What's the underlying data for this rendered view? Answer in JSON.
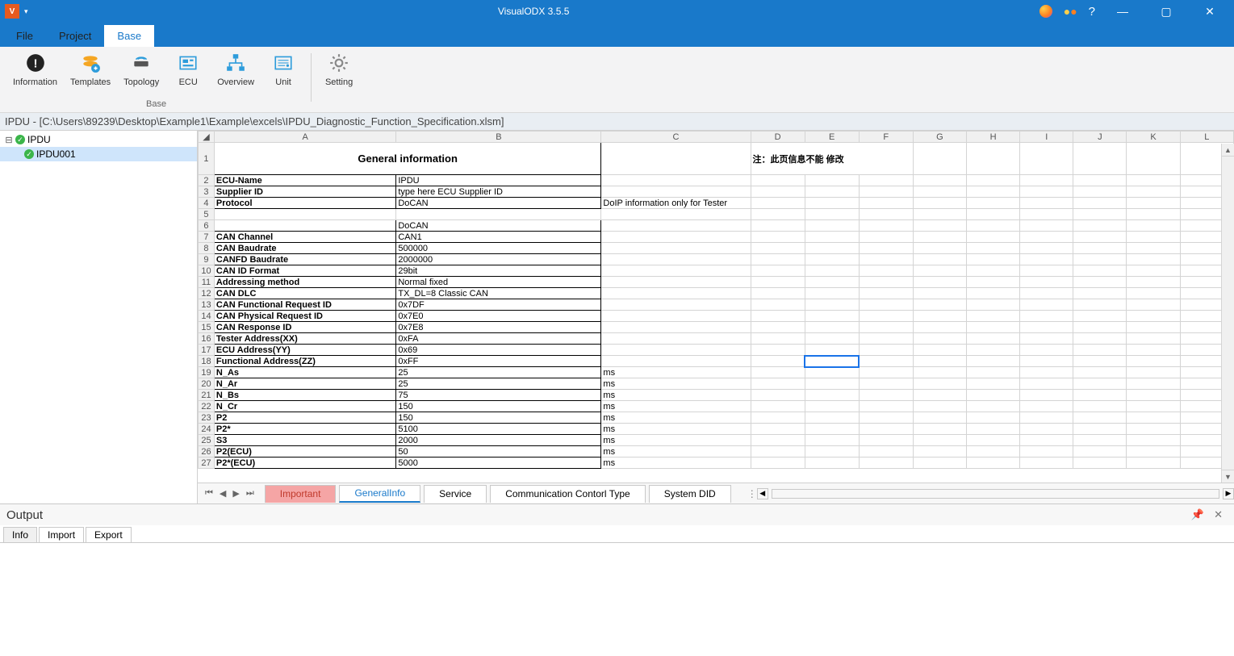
{
  "app": {
    "title": "VisualODX 3.5.5",
    "logo": "V"
  },
  "menuTabs": [
    {
      "label": "File",
      "active": false
    },
    {
      "label": "Project",
      "active": false
    },
    {
      "label": "Base",
      "active": true
    }
  ],
  "ribbon": {
    "groups": [
      {
        "label": "Base",
        "items": [
          {
            "label": "Information",
            "icon": "info"
          },
          {
            "label": "Templates",
            "icon": "templates"
          },
          {
            "label": "Topology",
            "icon": "topology"
          },
          {
            "label": "ECU",
            "icon": "ecu"
          },
          {
            "label": "Overview",
            "icon": "overview"
          },
          {
            "label": "Unit",
            "icon": "unit"
          }
        ]
      },
      {
        "label": "",
        "items": [
          {
            "label": "Setting",
            "icon": "setting"
          }
        ]
      }
    ]
  },
  "breadcrumb": "IPDU - [C:\\Users\\89239\\Desktop\\Example1\\Example\\excels\\IPDU_Diagnostic_Function_Specification.xlsm]",
  "tree": {
    "root": {
      "label": "IPDU"
    },
    "child": {
      "label": "IPDU001"
    }
  },
  "sheet": {
    "columns": [
      "A",
      "B",
      "C",
      "D",
      "E",
      "F",
      "G",
      "H",
      "I",
      "J",
      "K",
      "L"
    ],
    "title": "General information",
    "note": "注：此页信息不能 修改",
    "rows": [
      {
        "n": 2,
        "a": "ECU-Name",
        "b": "IPDU",
        "c": "",
        "bold": true,
        "thick": true
      },
      {
        "n": 3,
        "a": "Supplier ID",
        "b": "type here ECU Supplier ID",
        "c": "",
        "bold": true,
        "thick": true
      },
      {
        "n": 4,
        "a": "Protocol",
        "b": "DoCAN",
        "c": "DoIP information only for Tester",
        "bold": true,
        "thick": true
      },
      {
        "n": 5,
        "a": "",
        "b": "",
        "c": ""
      },
      {
        "n": 6,
        "a": "",
        "b": "DoCAN",
        "c": "",
        "bold": true,
        "thick": true
      },
      {
        "n": 7,
        "a": "CAN Channel",
        "b": "CAN1",
        "c": "",
        "bold": true,
        "thick": true
      },
      {
        "n": 8,
        "a": "CAN Baudrate",
        "b": "500000",
        "c": "",
        "bold": true,
        "thick": true
      },
      {
        "n": 9,
        "a": "CANFD Baudrate",
        "b": "2000000",
        "c": "",
        "bold": true,
        "thick": true
      },
      {
        "n": 10,
        "a": "CAN ID Format",
        "b": "29bit",
        "c": "",
        "bold": true,
        "thick": true
      },
      {
        "n": 11,
        "a": "Addressing method",
        "b": "Normal fixed",
        "c": "",
        "bold": true,
        "thick": true
      },
      {
        "n": 12,
        "a": "CAN DLC",
        "b": "TX_DL=8 Classic CAN",
        "c": "",
        "bold": true,
        "thick": true
      },
      {
        "n": 13,
        "a": "CAN Functional Request ID",
        "b": "0x7DF",
        "c": "",
        "bold": true,
        "thick": true
      },
      {
        "n": 14,
        "a": "CAN Physical Request ID",
        "b": "0x7E0",
        "c": "",
        "bold": true,
        "thick": true
      },
      {
        "n": 15,
        "a": "CAN Response ID",
        "b": "0x7E8",
        "c": "",
        "bold": true,
        "thick": true
      },
      {
        "n": 16,
        "a": "Tester Address(XX)",
        "b": "0xFA",
        "c": "",
        "bold": true,
        "thick": true
      },
      {
        "n": 17,
        "a": "ECU Address(YY)",
        "b": "0x69",
        "c": "",
        "bold": true,
        "thick": true
      },
      {
        "n": 18,
        "a": "Functional Address(ZZ)",
        "b": "0xFF",
        "c": "",
        "bold": true,
        "thick": true
      },
      {
        "n": 19,
        "a": "N_As",
        "b": "25",
        "c": "ms",
        "bold": true,
        "thick": true
      },
      {
        "n": 20,
        "a": "N_Ar",
        "b": "25",
        "c": "ms",
        "bold": true,
        "thick": true
      },
      {
        "n": 21,
        "a": "N_Bs",
        "b": "75",
        "c": "ms",
        "bold": true,
        "thick": true
      },
      {
        "n": 22,
        "a": "N_Cr",
        "b": "150",
        "c": "ms",
        "bold": true,
        "thick": true
      },
      {
        "n": 23,
        "a": "P2",
        "b": "150",
        "c": "ms",
        "bold": true,
        "thick": true
      },
      {
        "n": 24,
        "a": "P2*",
        "b": "5100",
        "c": "ms",
        "bold": true,
        "thick": true
      },
      {
        "n": 25,
        "a": "S3",
        "b": "2000",
        "c": "ms",
        "bold": true,
        "thick": true
      },
      {
        "n": 26,
        "a": "P2(ECU)",
        "b": "50",
        "c": "ms",
        "bold": true,
        "thick": true
      },
      {
        "n": 27,
        "a": "P2*(ECU)",
        "b": "5000",
        "c": "ms",
        "bold": true,
        "thick": true
      }
    ],
    "selectedCell": {
      "row": 18,
      "col": "E"
    },
    "tabs": [
      {
        "label": "Important",
        "style": "important"
      },
      {
        "label": "GeneralInfo",
        "style": "active"
      },
      {
        "label": "Service",
        "style": ""
      },
      {
        "label": "Communication Contorl Type",
        "style": ""
      },
      {
        "label": "System DID",
        "style": ""
      }
    ]
  },
  "output": {
    "title": "Output",
    "tabs": [
      "Info",
      "Import",
      "Export"
    ],
    "activeTab": "Info"
  }
}
